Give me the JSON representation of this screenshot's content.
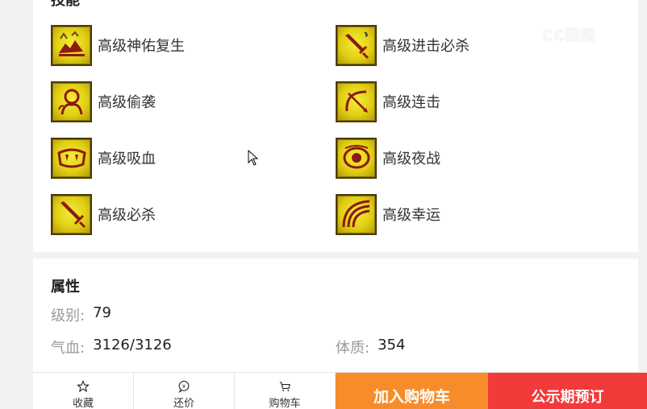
{
  "skills_section": {
    "title": "技能",
    "skills": [
      {
        "name": "高级神佑复生",
        "icon": "revival-beast-icon"
      },
      {
        "name": "高级进击必杀",
        "icon": "sword-advance-icon"
      },
      {
        "name": "高级偷袭",
        "icon": "sneak-figure-icon"
      },
      {
        "name": "高级连击",
        "icon": "combo-bow-icon"
      },
      {
        "name": "高级吸血",
        "icon": "fangs-icon"
      },
      {
        "name": "高级夜战",
        "icon": "eye-icon"
      },
      {
        "name": "高级必杀",
        "icon": "sword-icon"
      },
      {
        "name": "高级幸运",
        "icon": "rainbow-icon"
      }
    ]
  },
  "attributes_section": {
    "title": "属性",
    "level": {
      "label": "级别:",
      "value": "79"
    },
    "hp": {
      "label": "气血:",
      "value": "3126/3126"
    },
    "constitution": {
      "label": "体质:",
      "value": "354"
    }
  },
  "watermark": "CC回播",
  "bottom_bar": {
    "favorite_label": "收藏",
    "bargain_label": "还价",
    "cart_label": "购物车",
    "add_to_cart": "加入购物车",
    "preorder": "公示期预订"
  },
  "colors": {
    "orange": "#f78c2b",
    "red": "#f23a3a",
    "skill_yellow": "#e0cf14",
    "skill_dark": "#8b1a10"
  }
}
